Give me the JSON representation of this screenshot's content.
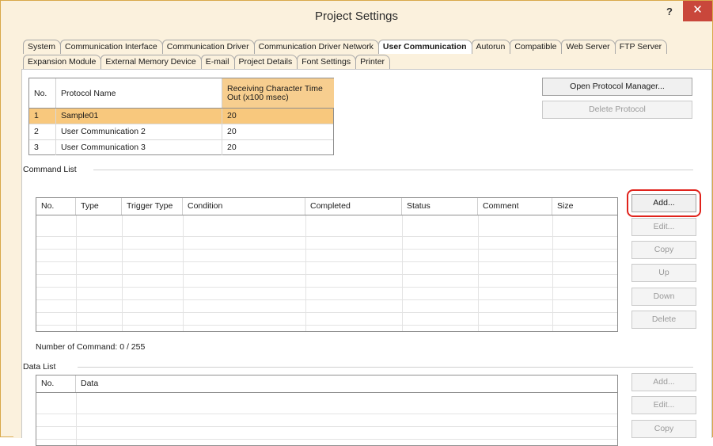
{
  "window": {
    "title": "Project Settings",
    "help": "?",
    "close": "✕"
  },
  "tabs_row1": [
    "System",
    "Communication Interface",
    "Communication Driver",
    "Communication Driver Network",
    "User Communication",
    "Autorun",
    "Compatible",
    "Web Server",
    "FTP Server"
  ],
  "tabs_row2": [
    "Expansion Module",
    "External Memory Device",
    "E-mail",
    "Project Details",
    "Font Settings",
    "Printer"
  ],
  "active_tab": "User Communication",
  "protocol_table": {
    "headers": {
      "no": "No.",
      "name": "Protocol Name",
      "timeout": "Receiving Character Time Out (x100 msec)"
    },
    "rows": [
      {
        "no": "1",
        "name": "Sample01",
        "timeout": "20",
        "selected": true
      },
      {
        "no": "2",
        "name": "User Communication 2",
        "timeout": "20",
        "selected": false
      },
      {
        "no": "3",
        "name": "User Communication 3",
        "timeout": "20",
        "selected": false
      }
    ]
  },
  "protocol_buttons": {
    "open": "Open Protocol Manager...",
    "delete": "Delete Protocol"
  },
  "command_list": {
    "label": "Command List",
    "headers": [
      "No.",
      "Type",
      "Trigger Type",
      "Condition",
      "Completed",
      "Status",
      "Comment",
      "Size"
    ],
    "count_text": "Number of Command: 0 / 255",
    "buttons": {
      "add": "Add...",
      "edit": "Edit...",
      "copy": "Copy",
      "up": "Up",
      "down": "Down",
      "delete": "Delete"
    }
  },
  "data_list": {
    "label": "Data List",
    "headers": [
      "No.",
      "Data"
    ],
    "buttons": {
      "add": "Add...",
      "edit": "Edit...",
      "copy": "Copy"
    }
  },
  "colors": {
    "accent": "#f8c87d",
    "highlight": "#e0231c",
    "close": "#c9473b",
    "frame": "#fbf1dd"
  }
}
